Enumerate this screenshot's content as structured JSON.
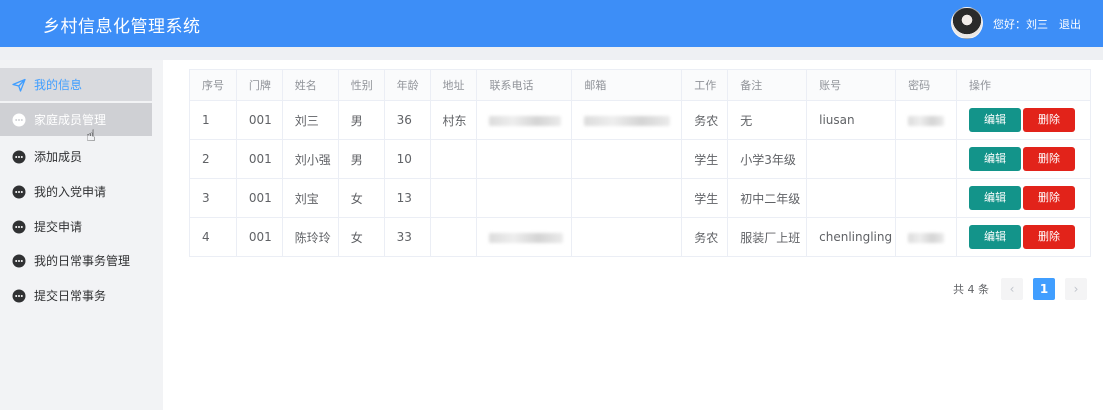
{
  "header": {
    "title": "乡村信息化管理系统",
    "greeting": "您好：刘三",
    "logout": "退出",
    "color": "#3d8ef7"
  },
  "sidebar": {
    "items": [
      {
        "label": "我的信息",
        "icon": "send-icon",
        "state": "active"
      },
      {
        "label": "家庭成员管理",
        "icon": "chat-dots-icon",
        "state": "hover"
      },
      {
        "label": "添加成员",
        "icon": "chat-dots-icon",
        "state": ""
      },
      {
        "label": "我的入党申请",
        "icon": "chat-dots-icon",
        "state": ""
      },
      {
        "label": "提交申请",
        "icon": "chat-dots-icon",
        "state": ""
      },
      {
        "label": "我的日常事务管理",
        "icon": "chat-dots-icon",
        "state": ""
      },
      {
        "label": "提交日常事务",
        "icon": "chat-dots-icon",
        "state": ""
      }
    ]
  },
  "table": {
    "columns": [
      "序号",
      "门牌",
      "姓名",
      "性别",
      "年龄",
      "地址",
      "联系电话",
      "邮箱",
      "工作",
      "备注",
      "账号",
      "密码",
      "操作"
    ],
    "rows": [
      {
        "no": "1",
        "door": "001",
        "name": "刘三",
        "gender": "男",
        "age": "36",
        "address": "村东",
        "job": "务农",
        "note": "无",
        "account": "liusan"
      },
      {
        "no": "2",
        "door": "001",
        "name": "刘小强",
        "gender": "男",
        "age": "10",
        "address": "",
        "job": "学生",
        "note": "小学3年级",
        "account": ""
      },
      {
        "no": "3",
        "door": "001",
        "name": "刘宝",
        "gender": "女",
        "age": "13",
        "address": "",
        "job": "学生",
        "note": "初中二年级",
        "account": ""
      },
      {
        "no": "4",
        "door": "001",
        "name": "陈玲玲",
        "gender": "女",
        "age": "33",
        "address": "",
        "job": "务农",
        "note": "服装厂上班",
        "account": "chenlingling"
      }
    ],
    "edit_label": "编辑",
    "delete_label": "删除"
  },
  "pagination": {
    "total": "共 4 条",
    "prev": "‹",
    "current": "1",
    "next": "›"
  }
}
